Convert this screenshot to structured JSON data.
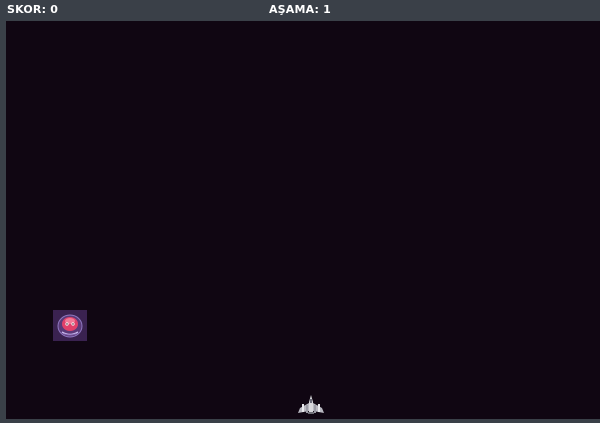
{
  "hud": {
    "score_label": "SKOR: 0",
    "level_label": "AŞAMA: 1"
  },
  "game": {
    "enemies": [
      {
        "type": "pink-alien-bubble",
        "icon": "alien-enemy-icon"
      }
    ],
    "player": {
      "icon": "spaceship-icon"
    }
  },
  "colors": {
    "hud_background": "#3a4048",
    "playfield_background": "#100612",
    "enemy_tile": "#3a2250",
    "enemy_body": "#e0406a",
    "ship": "#cfcfd4"
  }
}
